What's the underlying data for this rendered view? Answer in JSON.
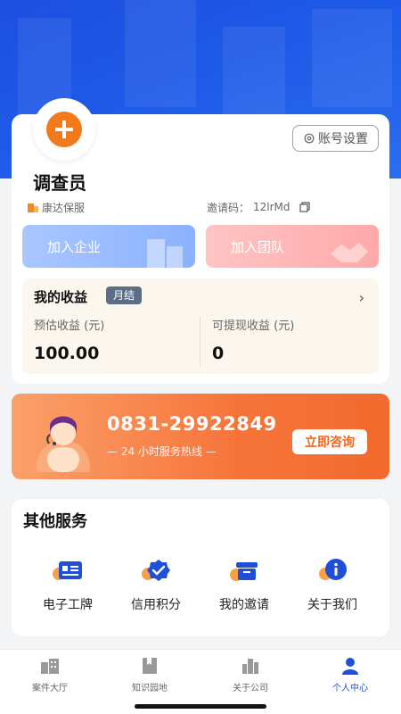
{
  "profile": {
    "role": "调查员",
    "company": "康达保服",
    "invite_label": "邀请码：",
    "invite_code": "12lrMd",
    "account_settings": "账号设置"
  },
  "actions": {
    "join_company": "加入企业",
    "join_team": "加入团队"
  },
  "earnings": {
    "title": "我的收益",
    "badge": "月结",
    "estimated_label": "预估收益 (元)",
    "estimated_value": "100.00",
    "withdrawable_label": "可提现收益 (元)",
    "withdrawable_value": "0"
  },
  "hotline": {
    "number": "0831-29922849",
    "subtitle": "— 24 小时服务热线 —",
    "button": "立即咨询"
  },
  "services": {
    "title": "其他服务",
    "items": [
      {
        "label": "电子工牌",
        "icon": "badge-card-icon"
      },
      {
        "label": "信用积分",
        "icon": "credit-check-icon"
      },
      {
        "label": "我的邀请",
        "icon": "invite-box-icon"
      },
      {
        "label": "关于我们",
        "icon": "info-icon"
      }
    ]
  },
  "tabs": [
    {
      "label": "案件大厅",
      "icon": "case-hall-icon"
    },
    {
      "label": "知识园地",
      "icon": "knowledge-icon"
    },
    {
      "label": "关于公司",
      "icon": "company-icon"
    },
    {
      "label": "个人中心",
      "icon": "person-icon"
    }
  ],
  "colors": {
    "brand_blue": "#1f4fd6",
    "accent_orange": "#f07a1c",
    "active_tab": "#1f4fd6",
    "inactive_tab": "#999999"
  }
}
